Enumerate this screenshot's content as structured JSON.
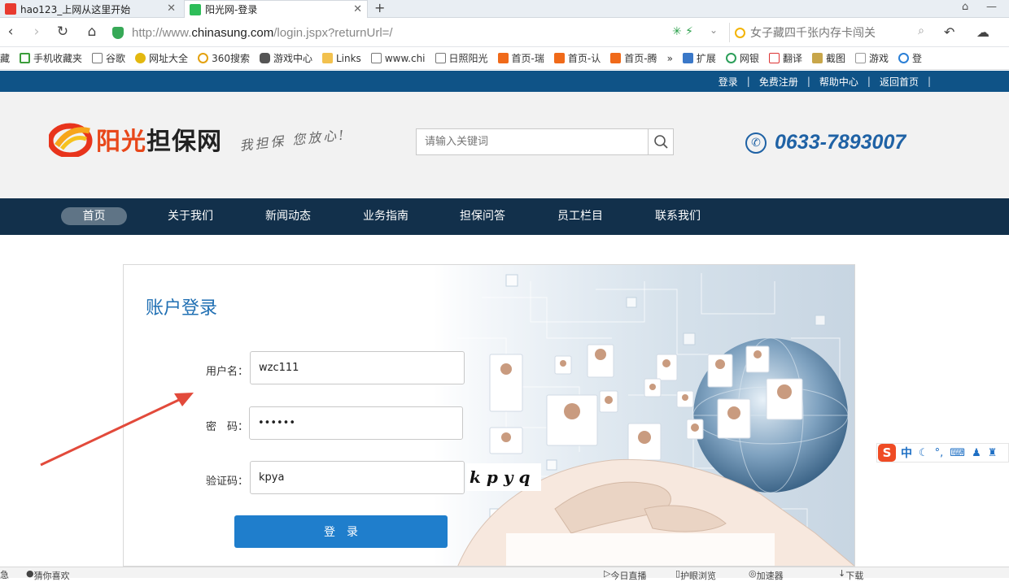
{
  "browser": {
    "tabs": [
      {
        "title": "hao123_上网从这里开始",
        "active": false
      },
      {
        "title": "阳光网-登录",
        "active": true
      }
    ],
    "new_tab": "+",
    "url_prefix": "http://www.",
    "url_domain": "chinasung.com",
    "url_path": "/login.jspx?returnUrl=/",
    "search_text": "女子藏四千张内存卡闯关",
    "bookmarks": [
      "藏",
      "手机收藏夹",
      "谷歌",
      "网址大全",
      "360搜索",
      "游戏中心",
      "Links",
      "www.chi",
      "日照阳光",
      "首页-瑞",
      "首页-认",
      "首页-腾",
      "»",
      "扩展",
      "网银",
      "翻译",
      "截图",
      "游戏",
      "登"
    ]
  },
  "site": {
    "top_links": [
      "登录",
      "免费注册",
      "帮助中心",
      "返回首页"
    ],
    "logo": {
      "part1": "阳光",
      "part2": "担保网"
    },
    "slogan": "我担保 您放心!",
    "search_placeholder": "请输入关键词",
    "phone": "0633-7893007",
    "nav": [
      "首页",
      "关于我们",
      "新闻动态",
      "业务指南",
      "担保问答",
      "员工栏目",
      "联系我们"
    ],
    "active_nav": "首页"
  },
  "login": {
    "title": "账户登录",
    "username_label": "用户名：",
    "username_value": "wzc111",
    "password_label": "密　码：",
    "password_value": "••••••",
    "captcha_label": "验证码：",
    "captcha_value": "kpya",
    "captcha_image_text": "kpyq",
    "submit_label": "登录"
  },
  "ime": {
    "mode": "中"
  },
  "statusbar": {
    "left1": "急",
    "left2": "猜你喜欢",
    "right": [
      "今日直播",
      "护眼浏览",
      "加速器",
      "下载"
    ]
  },
  "colors": {
    "topstrip": "#0f5387",
    "nav_bg": "#12304b",
    "accent": "#1f7ecc",
    "title_blue": "#1f6fb3",
    "arrow": "#e24a3b"
  }
}
